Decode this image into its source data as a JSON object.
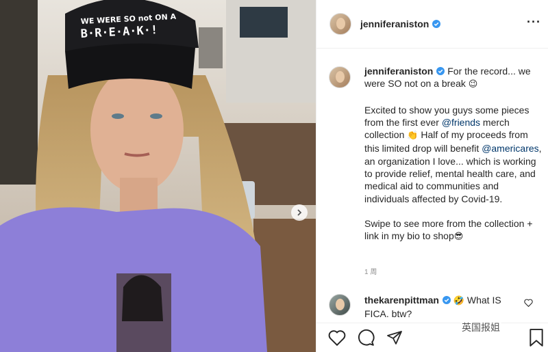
{
  "post": {
    "username": "jenniferaniston",
    "caption": {
      "line1": " For the record... we were SO not on a break ",
      "emoji1": "😉",
      "p2_a": "Excited to show you guys some pieces from the first ever ",
      "mention_friends": "@friends",
      "p2_b": " merch collection ",
      "emoji2": "👏",
      "p2_c": " Half of my proceeds from this limited drop will benefit ",
      "mention_americares": "@americares",
      "p2_d": ", an organization I love... which is working to provide relief, mental health care, and medical aid to communities and individuals affected by Covid-19.",
      "p3": "Swipe to see more from the collection + link in my bio to shop",
      "emoji3": "😎"
    },
    "time": "1 周",
    "hat_text_top": "WE WERE SO not ON A",
    "hat_text_break": "B·R·E·A·K·!"
  },
  "comment": {
    "username": "thekarenpittman",
    "emoji": "🤣",
    "text": " What IS FICA. btw?"
  },
  "watermark": "英国报姐",
  "colors": {
    "verified": "#3897f0",
    "mention": "#00376b",
    "sweatshirt": "#8d7fd8"
  },
  "icons": [
    "more-options-icon",
    "next-arrow-icon",
    "verified-icon",
    "heart-icon",
    "comment-icon",
    "share-icon",
    "bookmark-icon"
  ]
}
